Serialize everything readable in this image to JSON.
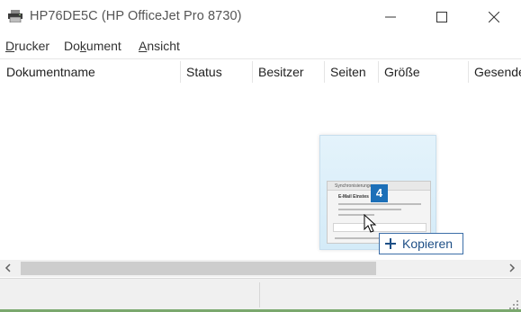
{
  "window": {
    "title": "HP76DE5C (HP OfficeJet Pro 8730)",
    "printer_icon": "printer-icon",
    "controls": {
      "minimize": "minimize-icon",
      "maximize": "maximize-icon",
      "close": "close-icon"
    }
  },
  "menu": {
    "drucker": {
      "accel": "D",
      "rest": "rucker"
    },
    "dokument": {
      "pre": "Do",
      "accel": "k",
      "rest": "ument"
    },
    "ansicht": {
      "accel": "A",
      "rest": "nsicht"
    }
  },
  "columns": [
    "Dokumentname",
    "Status",
    "Besitzer",
    "Seiten",
    "Größe",
    "Gesende"
  ],
  "drag": {
    "badge_count": "4",
    "action_label": "Kopieren",
    "thumb_title": "E-Mail Einstes",
    "thumb_header": "Synchronisierungen"
  },
  "colors": {
    "accent": "#1c6fb8",
    "tooltip_border": "#3c6ea8",
    "bottom_bar": "#7aa86e"
  }
}
